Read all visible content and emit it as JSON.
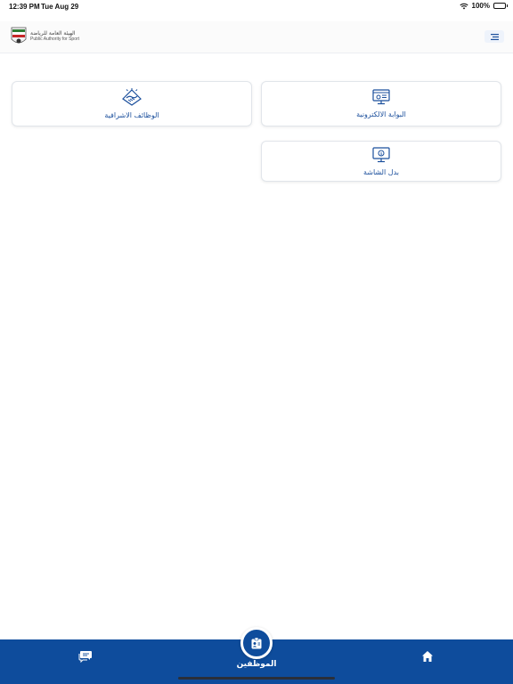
{
  "status_bar": {
    "time": "12:39 PM",
    "date": "Tue Aug 29",
    "battery": "100%",
    "icons": [
      "wifi-icon",
      "battery-icon"
    ]
  },
  "header": {
    "logo_ar": "الهيئة العامة للرياضة",
    "logo_en": "Public Authority for Sport",
    "menu_icon": "menu-icon"
  },
  "cards": [
    {
      "label": "البوابة الالكترونية",
      "icon": "portal-icon"
    },
    {
      "label": "الوظائف الاشرافية",
      "icon": "handshake-icon"
    },
    {
      "label": "بدل الشاشة",
      "icon": "screen-allowance-icon"
    }
  ],
  "bottom_nav": {
    "center_label": "الموظفين",
    "left_icon": "chat-icon",
    "center_icon": "employee-id-icon",
    "right_icon": "home-icon"
  },
  "colors": {
    "primary": "#0e4c9c",
    "accent_text": "#1b4f9c",
    "card_border": "#e1e5ea"
  }
}
